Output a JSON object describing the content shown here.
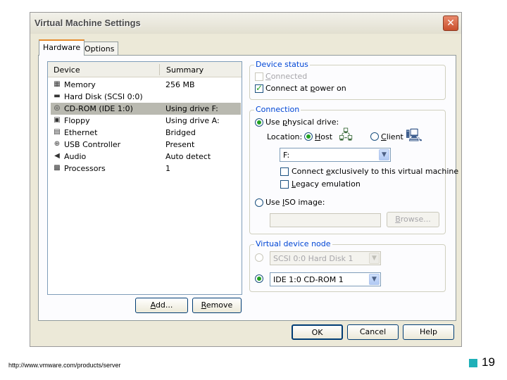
{
  "window": {
    "title": "Virtual Machine Settings",
    "close_glyph": "✕"
  },
  "tabs": [
    {
      "label": "Hardware",
      "active": true
    },
    {
      "label": "Options",
      "active": false
    }
  ],
  "device_list": {
    "headers": {
      "device": "Device",
      "summary": "Summary"
    },
    "rows": [
      {
        "icon": "memory-icon",
        "glyph": "▦",
        "device": "Memory",
        "summary": "256 MB",
        "selected": false
      },
      {
        "icon": "hard-disk-icon",
        "glyph": "▬",
        "device": "Hard Disk (SCSI 0:0)",
        "summary": "",
        "selected": false
      },
      {
        "icon": "cd-rom-icon",
        "glyph": "◎",
        "device": "CD-ROM (IDE 1:0)",
        "summary": "Using drive F:",
        "selected": true
      },
      {
        "icon": "floppy-icon",
        "glyph": "▣",
        "device": "Floppy",
        "summary": "Using drive A:",
        "selected": false
      },
      {
        "icon": "ethernet-icon",
        "glyph": "▤",
        "device": "Ethernet",
        "summary": "Bridged",
        "selected": false
      },
      {
        "icon": "usb-icon",
        "glyph": "⊕",
        "device": "USB Controller",
        "summary": "Present",
        "selected": false
      },
      {
        "icon": "audio-icon",
        "glyph": "◀",
        "device": "Audio",
        "summary": "Auto detect",
        "selected": false
      },
      {
        "icon": "processor-icon",
        "glyph": "▩",
        "device": "Processors",
        "summary": "1",
        "selected": false
      }
    ]
  },
  "list_buttons": {
    "add_pre": "",
    "add_u": "A",
    "add_post": "dd...",
    "remove_pre": "",
    "remove_u": "R",
    "remove_post": "emove"
  },
  "device_status": {
    "label": "Device status",
    "connected_pre": "",
    "connected_u": "C",
    "connected_post": "onnected",
    "connected_checked": false,
    "power_pre": "Connect at ",
    "power_u": "p",
    "power_post": "ower on",
    "power_checked": true
  },
  "connection": {
    "label": "Connection",
    "physical_pre": "Use ",
    "physical_u": "p",
    "physical_post": "hysical drive:",
    "location_label": "Location:",
    "host_pre": "",
    "host_u": "H",
    "host_post": "ost",
    "client_pre": "",
    "client_u": "C",
    "client_post": "lient",
    "drive_value": "F:",
    "exclusive_pre": "Connect ",
    "exclusive_u": "e",
    "exclusive_post": "xclusively to this virtual machine",
    "legacy_pre": "",
    "legacy_u": "L",
    "legacy_post": "egacy emulation",
    "iso_pre": "Use ",
    "iso_u": "I",
    "iso_post": "SO image:",
    "browse_pre": "",
    "browse_u": "B",
    "browse_post": "rowse..."
  },
  "virtual_node": {
    "label": "Virtual device node",
    "scsi_value": "SCSI 0:0  Hard Disk 1",
    "ide_value": "IDE 1:0  CD-ROM 1"
  },
  "dialog_buttons": {
    "ok": "OK",
    "cancel": "Cancel",
    "help": "Help"
  },
  "footer": {
    "url": "http://www.vmware.com/products/server",
    "page_number": "19"
  },
  "colors": {
    "accent_square": "#1fb0b8",
    "group_label": "#0046d5",
    "tab_highlight": "#e68b2c"
  }
}
